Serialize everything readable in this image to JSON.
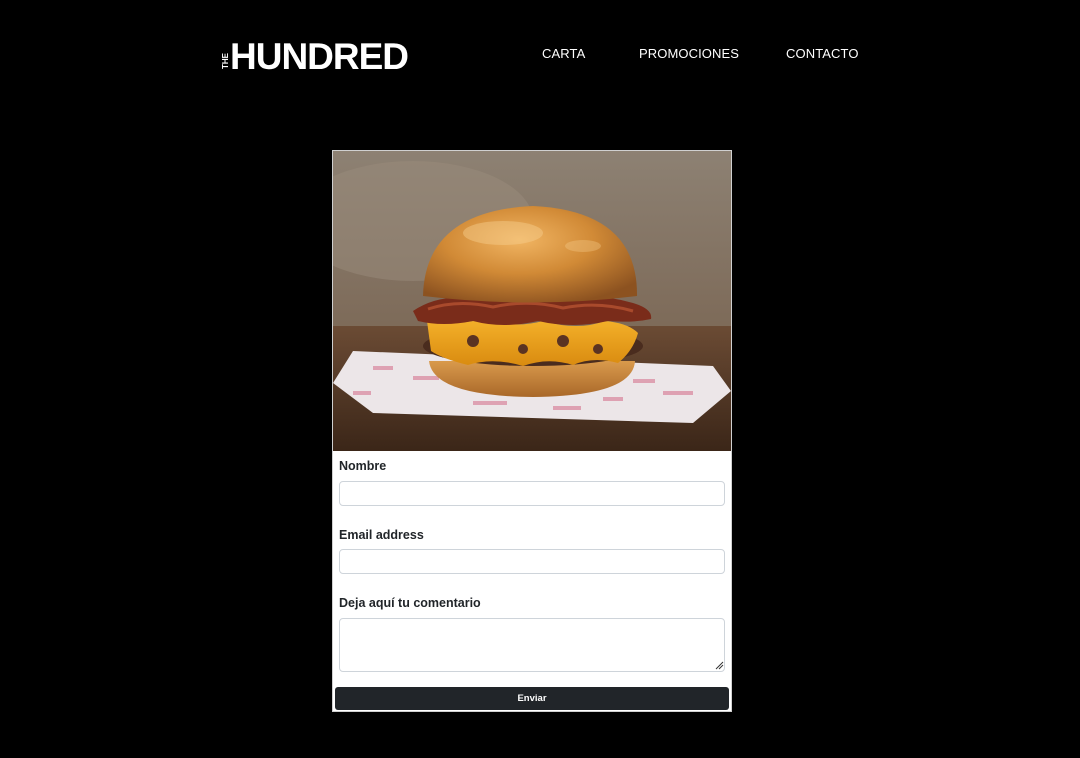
{
  "header": {
    "logo_small": "THE",
    "logo_main": "HUNDRED",
    "nav": [
      {
        "label": "CARTA"
      },
      {
        "label": "PROMOCIONES"
      },
      {
        "label": "CONTACTO"
      }
    ]
  },
  "form": {
    "name_label": "Nombre",
    "name_value": "",
    "email_label": "Email address",
    "email_value": "",
    "comment_label": "Deja aquí tu comentario",
    "comment_value": "",
    "submit_label": "Enviar"
  },
  "colors": {
    "background": "#000000",
    "card": "#ffffff",
    "button": "#212529",
    "nav_text": "#ffffff"
  },
  "images": {
    "hero": "burger-photo"
  }
}
